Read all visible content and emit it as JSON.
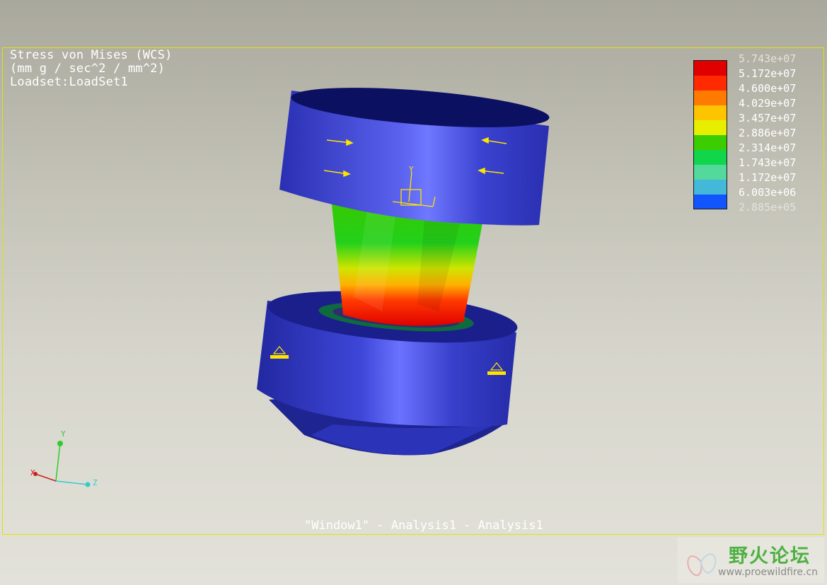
{
  "viewport": {
    "title_lines": [
      "Stress von Mises (WCS)",
      "(mm g / sec^2 / mm^2)",
      "Loadset:LoadSet1"
    ],
    "footer": "\"Window1\" - Analysis1 - Analysis1"
  },
  "legend": {
    "labels": [
      "5.743e+07",
      "5.172e+07",
      "4.600e+07",
      "4.029e+07",
      "3.457e+07",
      "2.886e+07",
      "2.314e+07",
      "1.743e+07",
      "1.172e+07",
      "6.003e+06",
      "2.885e+05"
    ],
    "colors": [
      "#e00000",
      "#ff2a00",
      "#ff7a00",
      "#ffc400",
      "#e8ee00",
      "#3ccd00",
      "#11d64b",
      "#54d99d",
      "#43b8d8",
      "#1155ff",
      "#0a10c8"
    ]
  },
  "triad": {
    "y_label": "Y",
    "x_label": "X",
    "z_label": "Z"
  },
  "csys_label": "Y",
  "watermark": {
    "title": "野火论坛",
    "url": "www.proewildfire.cn"
  }
}
